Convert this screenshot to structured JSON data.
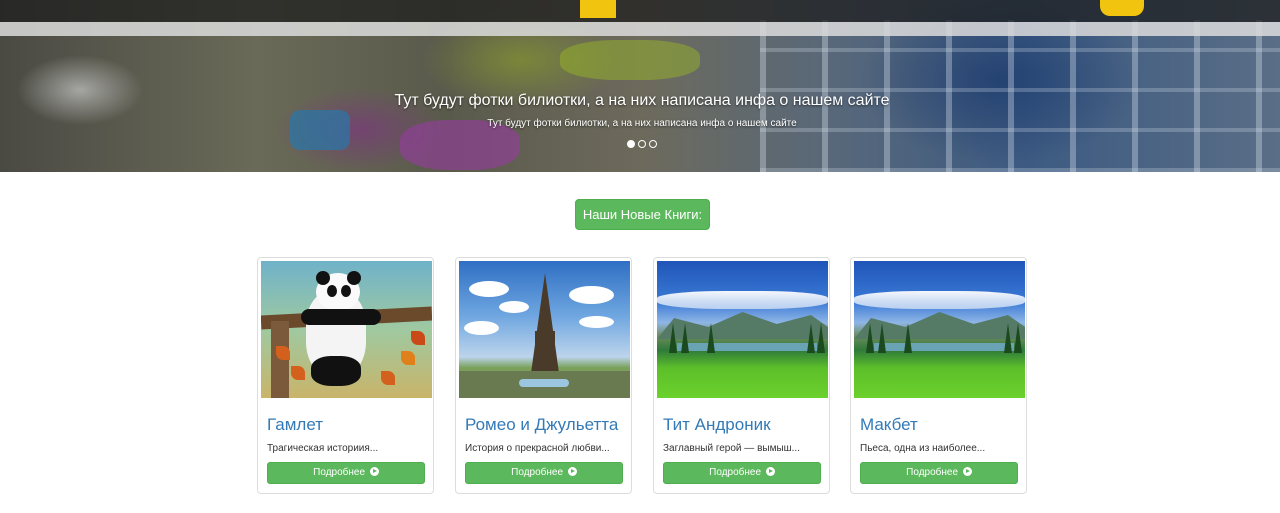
{
  "hero": {
    "caption_title": "Тут будут фотки билиотки, а на них написана инфа о нашем сайте",
    "caption_subtitle": "Тут будут фотки билиотки, а на них написана инфа о нашем сайте",
    "indicators_count": 3,
    "active_indicator": 1
  },
  "section": {
    "new_books_label": "Наши Новые Книги:"
  },
  "cards": [
    {
      "title": "Гамлет",
      "description": "Трагическая историия...",
      "button_label": "Подробнее",
      "image": "panda"
    },
    {
      "title": "Ромео и Джульетта",
      "description": "История о прекрасной любви...",
      "button_label": "Подробнее",
      "image": "eiffel-tower"
    },
    {
      "title": "Тит Андроник",
      "description": "Заглавный герой — вымыш...",
      "button_label": "Подробнее",
      "image": "green-meadow"
    },
    {
      "title": "Макбет",
      "description": "Пьеса, одна из наиболее...",
      "button_label": "Подробнее",
      "image": "green-meadow"
    }
  ],
  "colors": {
    "success_green": "#5cb85c",
    "link_blue": "#337ab7",
    "card_border": "#dddddd"
  }
}
